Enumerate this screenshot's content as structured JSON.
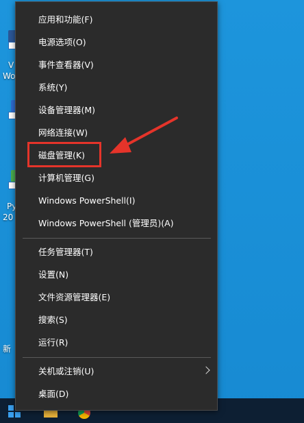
{
  "menu": {
    "group1": [
      {
        "label": "应用和功能(F)"
      },
      {
        "label": "电源选项(O)"
      },
      {
        "label": "事件查看器(V)"
      },
      {
        "label": "系统(Y)"
      },
      {
        "label": "设备管理器(M)"
      },
      {
        "label": "网络连接(W)"
      },
      {
        "label": "磁盘管理(K)"
      },
      {
        "label": "计算机管理(G)"
      },
      {
        "label": "Windows PowerShell(I)"
      },
      {
        "label": "Windows PowerShell (管理员)(A)"
      }
    ],
    "group2": [
      {
        "label": "任务管理器(T)"
      },
      {
        "label": "设置(N)"
      },
      {
        "label": "文件资源管理器(E)"
      },
      {
        "label": "搜索(S)"
      },
      {
        "label": "运行(R)"
      }
    ],
    "group3": [
      {
        "label": "关机或注销(U)",
        "has_submenu": true
      },
      {
        "label": "桌面(D)"
      }
    ]
  },
  "desktop": {
    "icons": [
      {
        "label_line1": "V",
        "label_line2": "Wo"
      },
      {
        "label_line1": "",
        "label_line2": ""
      },
      {
        "label_line1": "Py",
        "label_line2": "20"
      },
      {
        "label_line1": "新",
        "label_line2": ""
      }
    ]
  },
  "annotation": {
    "highlight_color": "#e5342a",
    "arrow_color": "#e5342a"
  },
  "colors": {
    "menu_bg": "#2b2b2b",
    "desktop_bg": "#1a8fd6",
    "taskbar_bg": "#0d1f33"
  }
}
